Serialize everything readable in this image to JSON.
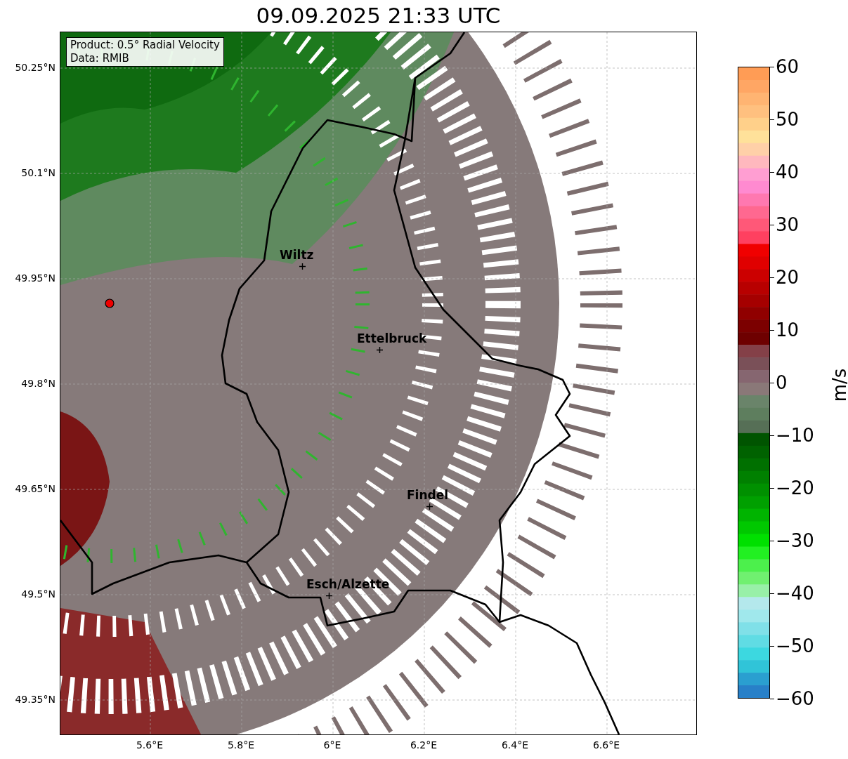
{
  "title": "09.09.2025 21:33 UTC",
  "info_box": {
    "lines": [
      "Product: 0.5° Radial Velocity",
      "Data: RMIB"
    ]
  },
  "map": {
    "cities": [
      {
        "name": "Wiltz"
      },
      {
        "name": "Ettelbruck"
      },
      {
        "name": "Findel"
      },
      {
        "name": "Esch/Alzette"
      }
    ],
    "y_ticks": [
      "50.25°N",
      "50.1°N",
      "49.95°N",
      "49.8°N",
      "49.65°N",
      "49.5°N",
      "49.35°N"
    ],
    "x_ticks": [
      "5.6°E",
      "5.8°E",
      "6°E",
      "6.2°E",
      "6.4°E",
      "6.6°E"
    ]
  },
  "colorbar": {
    "label": "m/s",
    "ticks": [
      "60",
      "50",
      "40",
      "30",
      "20",
      "10",
      "0",
      "−10",
      "−20",
      "−30",
      "−40",
      "−50",
      "−60"
    ]
  }
}
